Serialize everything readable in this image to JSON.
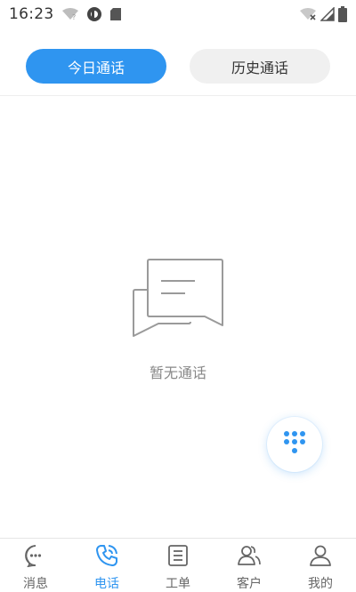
{
  "status_bar": {
    "time": "16:23"
  },
  "tabs": {
    "today": "今日通话",
    "history": "历史通话"
  },
  "empty_state": {
    "text": "暂无通话"
  },
  "bottom_nav": {
    "items": [
      {
        "label": "消息",
        "icon": "chat-bubble-icon"
      },
      {
        "label": "电话",
        "icon": "phone-icon"
      },
      {
        "label": "工单",
        "icon": "clipboard-icon"
      },
      {
        "label": "客户",
        "icon": "customers-icon"
      },
      {
        "label": "我的",
        "icon": "person-icon"
      }
    ],
    "active_index": 1
  },
  "colors": {
    "accent": "#2f95f0",
    "inactive": "#666666"
  }
}
